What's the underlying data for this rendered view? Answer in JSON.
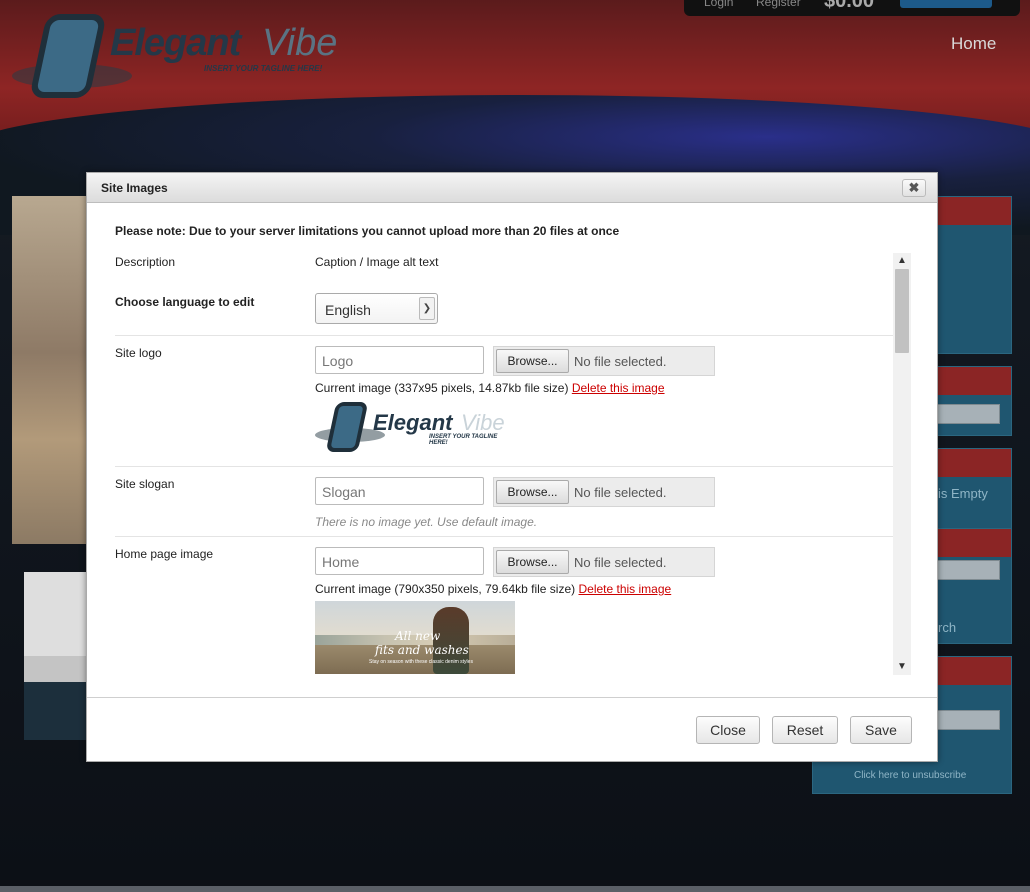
{
  "site": {
    "header": {
      "login": "Login",
      "register": "Register",
      "cart_amount": "$0.00",
      "logo_word1": "Elegant",
      "logo_word2": "Vibe",
      "tagline": "INSERT YOUR TAGLINE HERE!",
      "nav_home": "Home"
    },
    "sidebar": {
      "cart_empty": "is Empty",
      "search_fragment": "rch",
      "unsubscribe": "Click here to unsubscribe"
    }
  },
  "modal": {
    "title": "Site Images",
    "close_glyph": "✖",
    "notice": "Please note: Due to your server limitations you cannot upload more than 20 files at once",
    "table": {
      "header_description": "Description",
      "header_caption": "Caption / Image alt text",
      "language_label": "Choose language to edit",
      "language_selected": "English"
    },
    "rows": [
      {
        "label": "Site logo",
        "caption_value": "Logo",
        "browse_label": "Browse...",
        "file_status": "No file selected.",
        "current_text": "Current image (337x95 pixels, 14.87kb file size)",
        "delete_label": "Delete this image"
      },
      {
        "label": "Site slogan",
        "caption_value": "Slogan",
        "browse_label": "Browse...",
        "file_status": "No file selected.",
        "no_image_text": "There is no image yet. Use default image."
      },
      {
        "label": "Home page image",
        "caption_value": "Home",
        "browse_label": "Browse...",
        "file_status": "No file selected.",
        "current_text": "Current image (790x350 pixels, 79.64kb file size)",
        "delete_label": "Delete this image",
        "thumb_line1": "All new",
        "thumb_line2": "fits and washes",
        "thumb_line3": "Stay on season with these classic denim styles"
      }
    ],
    "buttons": {
      "close": "Close",
      "reset": "Reset",
      "save": "Save"
    }
  }
}
